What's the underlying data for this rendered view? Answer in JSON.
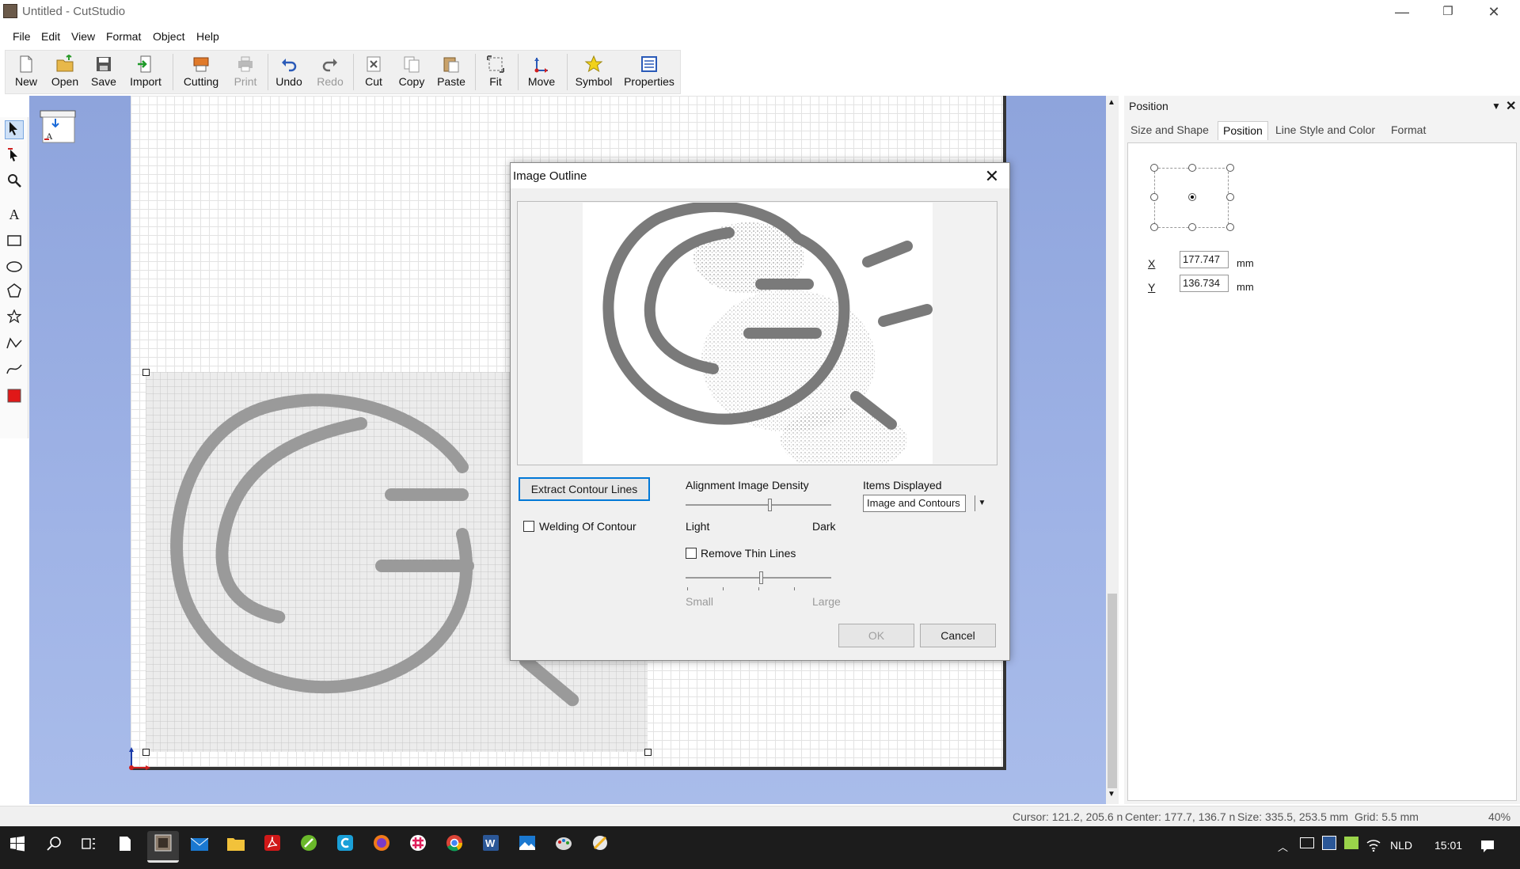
{
  "window": {
    "title": "Untitled - CutStudio",
    "min": "—",
    "max": "❐",
    "close": "✕"
  },
  "menu": [
    "File",
    "Edit",
    "View",
    "Format",
    "Object",
    "Help"
  ],
  "toolbar": {
    "new": "New",
    "open": "Open",
    "save": "Save",
    "import": "Import",
    "cutting": "Cutting",
    "print": "Print",
    "undo": "Undo",
    "redo": "Redo",
    "cut": "Cut",
    "copy": "Copy",
    "paste": "Paste",
    "fit": "Fit",
    "move": "Move",
    "symbol": "Symbol",
    "properties": "Properties"
  },
  "panel": {
    "title": "Position",
    "tabs": [
      "Size and Shape",
      "Position",
      "Line Style and Color",
      "Format"
    ],
    "x_label": "X",
    "x_value": "177.747",
    "x_unit": "mm",
    "y_label": "Y",
    "y_value": "136.734",
    "y_unit": "mm"
  },
  "dialog": {
    "title": "Image Outline",
    "extract_button": "Extract Contour Lines",
    "welding_label": "Welding Of Contour",
    "welding_checked": false,
    "density_label": "Alignment Image Density",
    "density_min": "Light",
    "density_max": "Dark",
    "density_value": 0.58,
    "items_label": "Items Displayed",
    "items_selected": "Image and Contours",
    "remove_thin_label": "Remove Thin Lines",
    "remove_thin_checked": false,
    "thin_min": "Small",
    "thin_max": "Large",
    "thin_value": 0.52,
    "ok": "OK",
    "cancel": "Cancel"
  },
  "status": {
    "cursor": "Cursor: 121.2, 205.6 n",
    "center": "Center: 177.7, 136.7 n",
    "size": "Size: 335.5, 253.5 mm",
    "grid": "Grid: 5.5 mm",
    "zoom": "40%"
  },
  "taskbar": {
    "lang": "NLD",
    "time": "15:01"
  }
}
